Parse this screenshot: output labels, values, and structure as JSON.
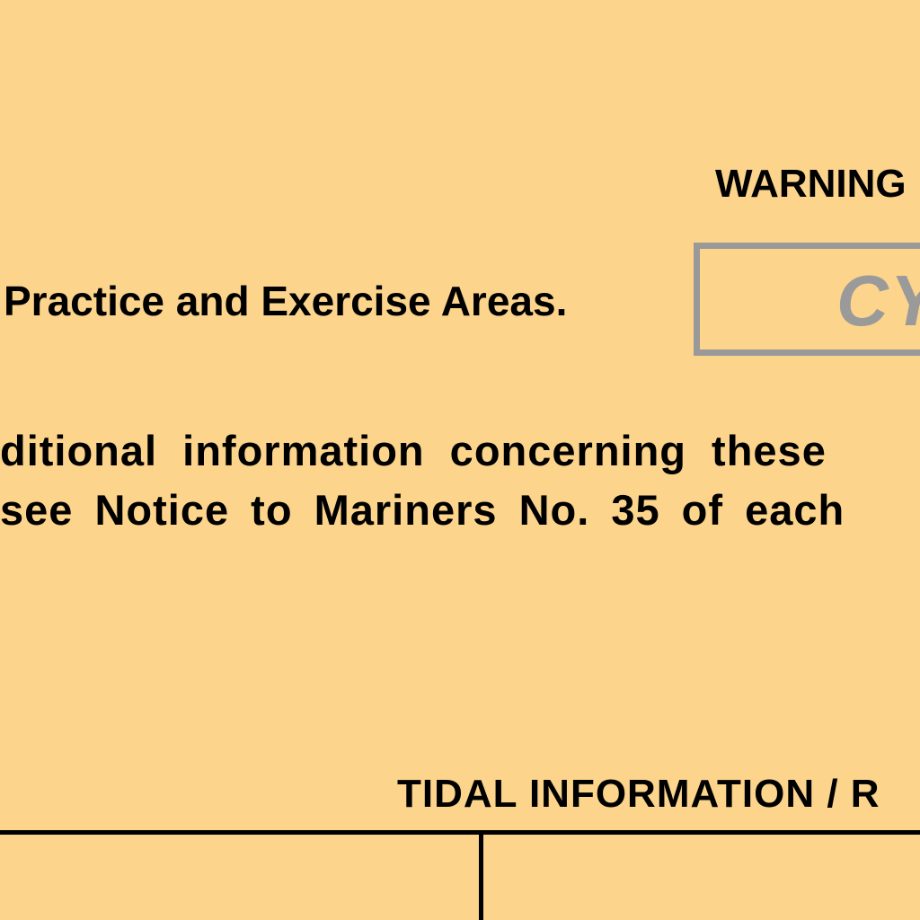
{
  "document": {
    "warning_heading": "WARNING",
    "practice_line": "Practice and Exercise Areas.",
    "stamp_text": "CY",
    "info_line_1": "ditional information concerning these",
    "info_line_2": "see Notice to Mariners No. 35 of each",
    "tidal_heading": "TIDAL INFORMATION / R"
  },
  "colors": {
    "paper": "#fcd48c",
    "text": "#000000",
    "stamp": "#999999"
  }
}
